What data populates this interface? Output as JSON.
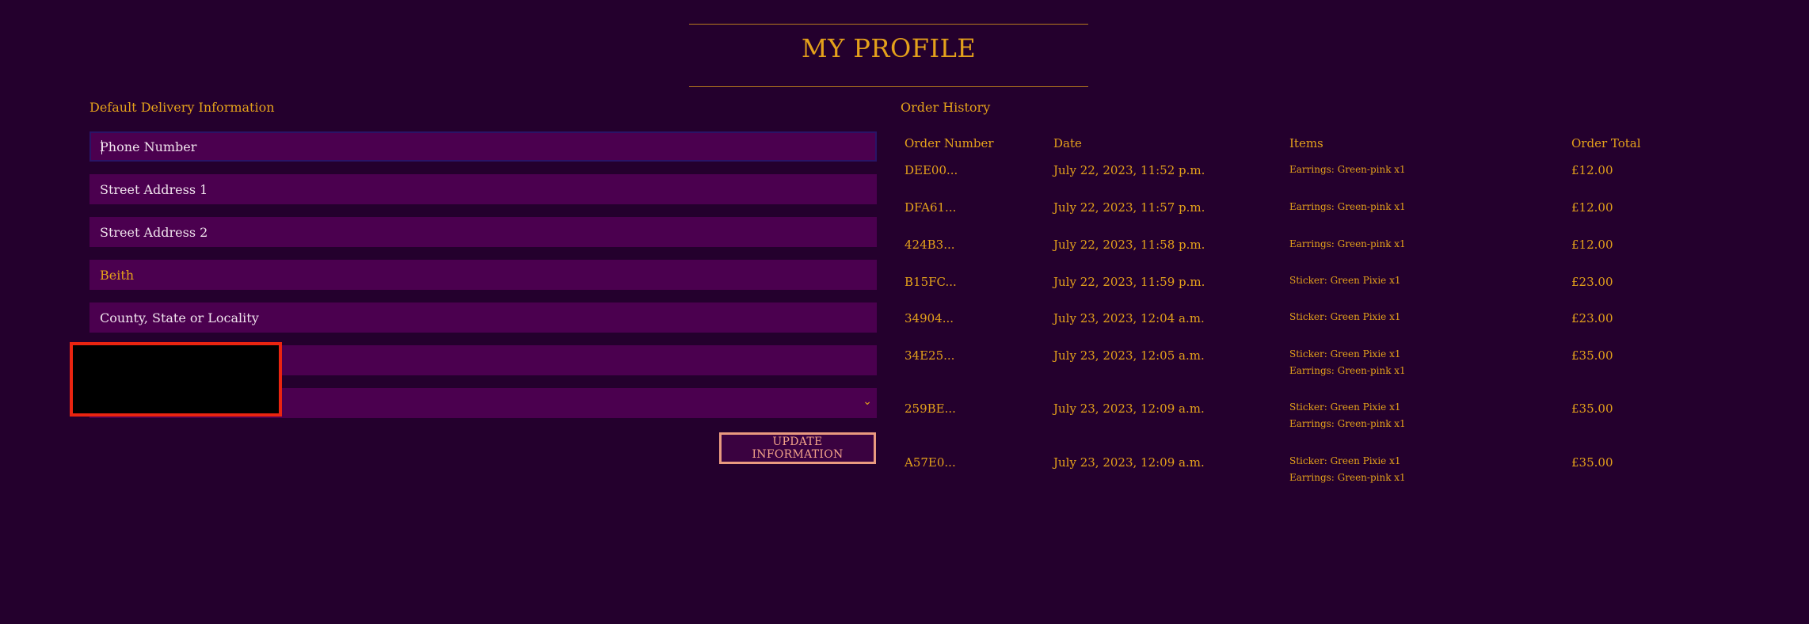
{
  "page_title": "MY PROFILE",
  "delivery": {
    "heading": "Default Delivery Information",
    "phone_placeholder": "Phone Number",
    "street1_placeholder": "Street Address 1",
    "street2_placeholder": "Street Address 2",
    "town_value": "Beith",
    "county_placeholder": "County, State or Locality",
    "update_button": "UPDATE INFORMATION"
  },
  "orders": {
    "heading": "Order History",
    "columns": {
      "number": "Order Number",
      "date": "Date",
      "items": "Items",
      "total": "Order Total"
    },
    "rows": [
      {
        "number": "DEE00...",
        "date": "July 22, 2023, 11:52 p.m.",
        "items": [
          "Earrings: Green-pink x1"
        ],
        "total": "£12.00"
      },
      {
        "number": "DFA61...",
        "date": "July 22, 2023, 11:57 p.m.",
        "items": [
          "Earrings: Green-pink x1"
        ],
        "total": "£12.00"
      },
      {
        "number": "424B3...",
        "date": "July 22, 2023, 11:58 p.m.",
        "items": [
          "Earrings: Green-pink x1"
        ],
        "total": "£12.00"
      },
      {
        "number": "B15FC...",
        "date": "July 22, 2023, 11:59 p.m.",
        "items": [
          "Sticker: Green Pixie x1"
        ],
        "total": "£23.00"
      },
      {
        "number": "34904...",
        "date": "July 23, 2023, 12:04 a.m.",
        "items": [
          "Sticker: Green Pixie x1"
        ],
        "total": "£23.00"
      },
      {
        "number": "34E25...",
        "date": "July 23, 2023, 12:05 a.m.",
        "items": [
          "Sticker: Green Pixie x1",
          "Earrings: Green-pink x1"
        ],
        "total": "£35.00"
      },
      {
        "number": "259BE...",
        "date": "July 23, 2023, 12:09 a.m.",
        "items": [
          "Sticker: Green Pixie x1",
          "Earrings: Green-pink x1"
        ],
        "total": "£35.00"
      },
      {
        "number": "A57E0...",
        "date": "July 23, 2023, 12:09 a.m.",
        "items": [
          "Sticker: Green Pixie x1",
          "Earrings: Green-pink x1"
        ],
        "total": "£35.00"
      }
    ]
  },
  "colors": {
    "background": "#24002d",
    "field_background": "#4b004f",
    "accent": "#e4a11b",
    "button_border": "#e99a7f",
    "redaction_border": "#ea2410"
  }
}
